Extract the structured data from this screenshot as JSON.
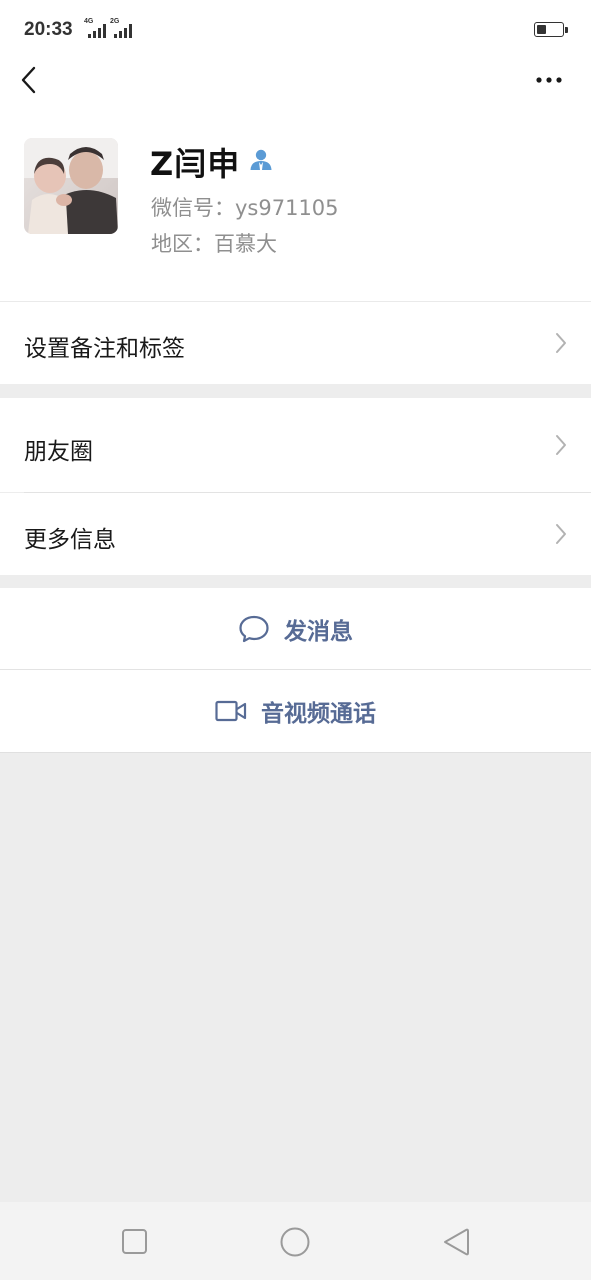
{
  "status_bar": {
    "time": "20:33",
    "signal1_tag": "⁴⁶4G",
    "signal2_tag": "2G",
    "battery_level": 0.4
  },
  "nav": {
    "back_icon": "chevron-left-icon",
    "more_icon": "ellipsis-icon"
  },
  "profile": {
    "name": "Z闫申",
    "wechat_id": "微信号：ys971105",
    "region": "地区：百慕大"
  },
  "cells": {
    "remark": "设置备注和标签",
    "moments": "朋友圈",
    "more_info": "更多信息"
  },
  "actions": {
    "message": "发消息",
    "video_call": "音视频通话"
  },
  "colors": {
    "link_blue": "#576b95",
    "background": "#ededed",
    "secondary_text": "#8f8f8f"
  }
}
